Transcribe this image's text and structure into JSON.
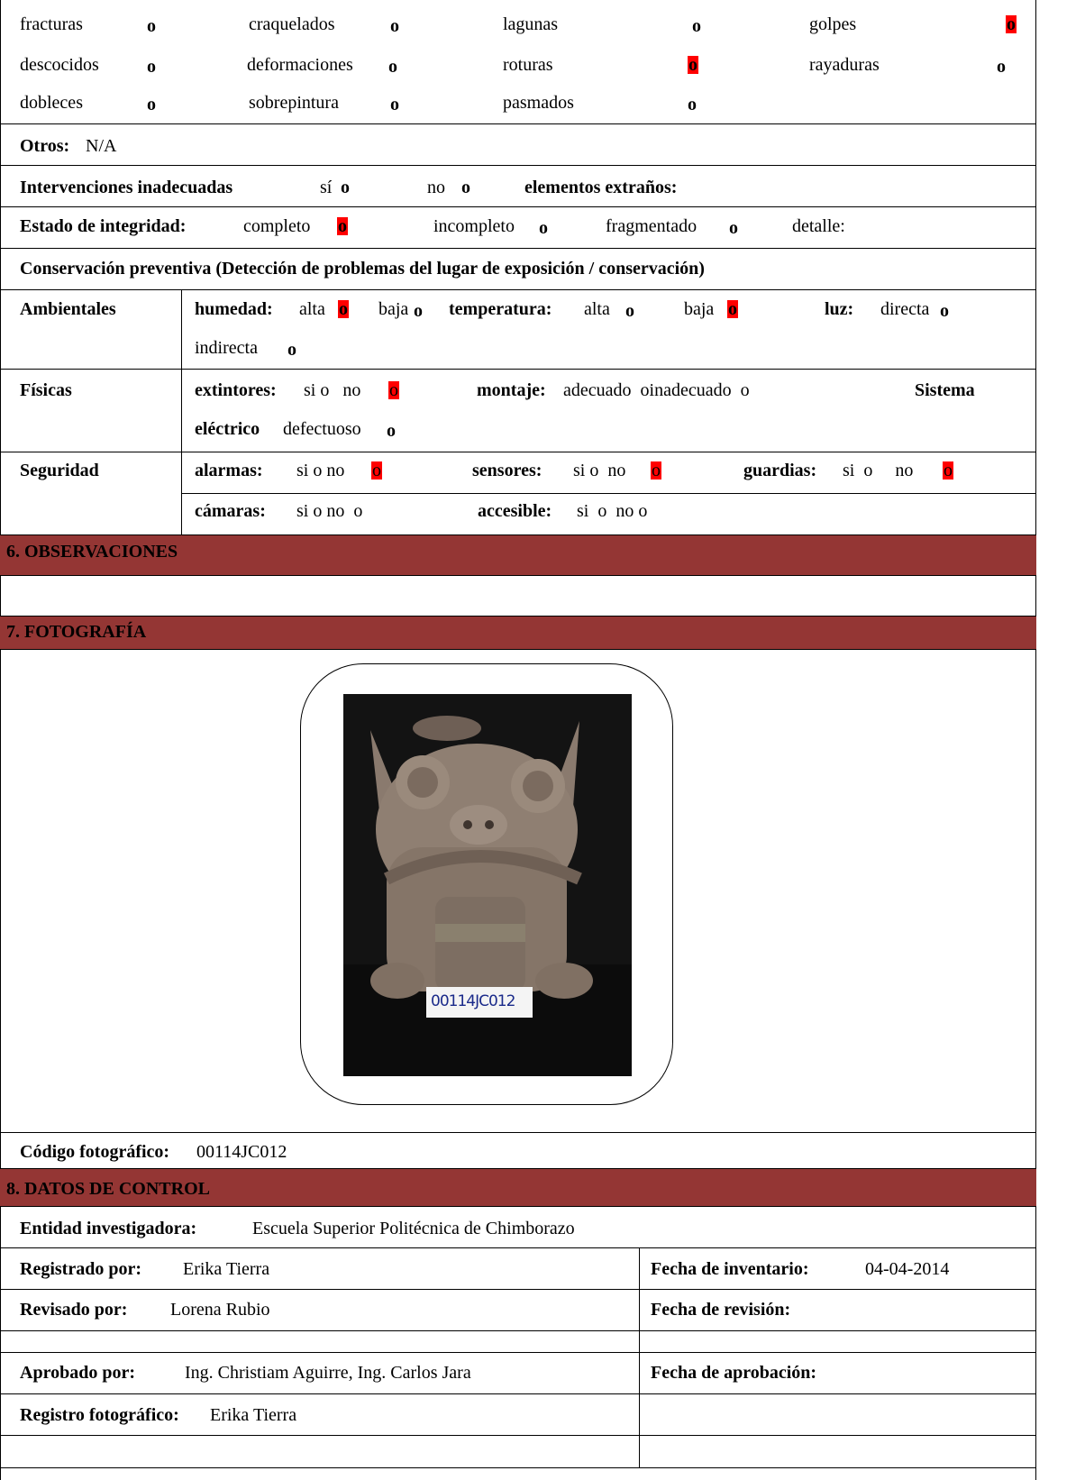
{
  "damage": {
    "r1": {
      "fracturas": "fracturas",
      "fracturas_o": "o",
      "craquelados": "craquelados",
      "craquelados_o": "o",
      "lagunas": "lagunas",
      "lagunas_o": "o",
      "golpes": "golpes",
      "golpes_o": "o"
    },
    "r2": {
      "descocidos": "descocidos",
      "descocidos_o": "o",
      "deformaciones": "deformaciones",
      "deformaciones_o": "o",
      "roturas": "roturas",
      "roturas_o": "o",
      "rayaduras": "rayaduras",
      "rayaduras_o": "o"
    },
    "r3": {
      "dobleces": "dobleces",
      "dobleces_o": "o",
      "sobrepintura": "sobrepintura",
      "sobrepintura_o": "o",
      "pasmados": "pasmados",
      "pasmados_o": "o"
    }
  },
  "otros": {
    "label": "Otros:",
    "value": "N/A"
  },
  "intervenciones": {
    "label": "Intervenciones inadecuadas",
    "si": "sí",
    "si_o": "o",
    "no": "no",
    "no_o": "o",
    "extranos": "elementos extraños:"
  },
  "integridad": {
    "label": "Estado de integridad:",
    "completo": "completo",
    "completo_o": "o",
    "incompleto": "incompleto",
    "incompleto_o": "o",
    "fragmentado": "fragmentado",
    "fragmentado_o": "o",
    "detalle": "detalle:"
  },
  "conservacion": {
    "title": "Conservación preventiva (Detección de problemas del lugar de exposición / conservación)"
  },
  "ambientales": {
    "label": "Ambientales",
    "humedad": "humedad:",
    "alta": "alta",
    "alta_o": "o",
    "baja": "baja",
    "baja_o": "o",
    "temperatura": "temperatura:",
    "t_alta": "alta",
    "t_alta_o": "o",
    "t_baja": "baja",
    "t_baja_o": "o",
    "luz": "luz:",
    "directa": "directa",
    "directa_o": "o",
    "indirecta": "indirecta",
    "indirecta_o": "o"
  },
  "fisicas": {
    "label": "Físicas",
    "extintores": "extintores:",
    "ext_values": "si o   no",
    "ext_o": "o",
    "montaje": "montaje:",
    "montaje_values": "adecuado  oinadecuado  o",
    "sistema": "Sistema",
    "electrico": "eléctrico",
    "defectuoso": "defectuoso",
    "defectuoso_o": "o"
  },
  "seguridad": {
    "label": "Seguridad",
    "alarmas": "alarmas:",
    "alarmas_values": "si o no",
    "alarmas_o": "o",
    "sensores": "sensores:",
    "sensores_values": "si o  no",
    "sensores_o": "o",
    "guardias": "guardias:",
    "guardias_values": "si  o     no",
    "guardias_o": "o",
    "camaras": "cámaras:",
    "camaras_values": "si o no  o",
    "accesible": "accesible:",
    "accesible_values": "si  o  no o"
  },
  "sections": {
    "observaciones": "6. OBSERVACIONES",
    "fotografia": "7. FOTOGRAFÍA",
    "control": "8. DATOS DE CONTROL"
  },
  "photo": {
    "tag": "00114JC012"
  },
  "codigo": {
    "label": "Código fotográfico:",
    "value": "00114JC012"
  },
  "control": {
    "entidad_label": "Entidad investigadora:",
    "entidad": "Escuela Superior Politécnica de Chimborazo",
    "registrado_label": "Registrado por:",
    "registrado": "Erika Tierra",
    "fecha_inv_label": "Fecha de inventario:",
    "fecha_inv": "04-04-2014",
    "revisado_label": "Revisado por:",
    "revisado": "Lorena Rubio",
    "fecha_rev_label": "Fecha de revisión:",
    "aprobado_label": "Aprobado por:",
    "aprobado": "Ing. Christiam Aguirre, Ing. Carlos Jara",
    "fecha_apr_label": "Fecha de aprobación:",
    "registro_label": "Registro fotográfico:",
    "registro": "Erika Tierra"
  },
  "colors": {
    "section_bar": "#943634",
    "marked": "#ff0000"
  }
}
